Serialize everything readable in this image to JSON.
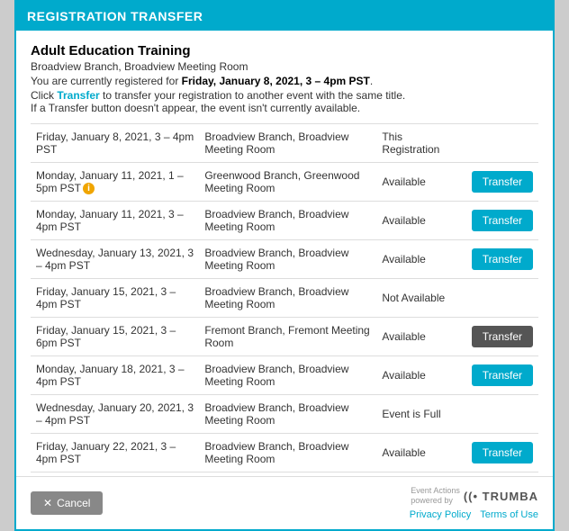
{
  "modal": {
    "header": "REGISTRATION TRANSFER",
    "event_title": "Adult Education Training",
    "event_location": "Broadview Branch, Broadview Meeting Room",
    "event_desc_prefix": "You are currently registered for ",
    "event_desc_bold": "Friday, January 8, 2021, 3 – 4pm PST",
    "event_desc_suffix": ".",
    "event_note_prefix": "Click ",
    "event_note_link": "Transfer",
    "event_note_suffix": " to transfer your registration to another event with the same title.",
    "event_note2": "If a Transfer button doesn't appear, the event isn't currently available."
  },
  "rows": [
    {
      "date": "Friday, January 8, 2021, 3 – 4pm PST",
      "location": "Broadview Branch, Broadview Meeting Room",
      "status": "This Registration",
      "has_button": false,
      "has_info": false,
      "active": false
    },
    {
      "date": "Monday, January 11, 2021, 1 – 5pm PST",
      "location": "Greenwood Branch, Greenwood Meeting Room",
      "status": "Available",
      "has_button": true,
      "has_info": true,
      "active": false
    },
    {
      "date": "Monday, January 11, 2021, 3 – 4pm PST",
      "location": "Broadview Branch, Broadview Meeting Room",
      "status": "Available",
      "has_button": true,
      "has_info": false,
      "active": false
    },
    {
      "date": "Wednesday, January 13, 2021, 3 – 4pm PST",
      "location": "Broadview Branch, Broadview Meeting Room",
      "status": "Available",
      "has_button": true,
      "has_info": false,
      "active": false
    },
    {
      "date": "Friday, January 15, 2021, 3 – 4pm PST",
      "location": "Broadview Branch, Broadview Meeting Room",
      "status": "Not Available",
      "has_button": false,
      "has_info": false,
      "active": false
    },
    {
      "date": "Friday, January 15, 2021, 3 – 6pm PST",
      "location": "Fremont Branch, Fremont Meeting Room",
      "status": "Available",
      "has_button": true,
      "has_info": false,
      "active": true
    },
    {
      "date": "Monday, January 18, 2021, 3 – 4pm PST",
      "location": "Broadview Branch, Broadview Meeting Room",
      "status": "Available",
      "has_button": true,
      "has_info": false,
      "active": false
    },
    {
      "date": "Wednesday, January 20, 2021, 3 – 4pm PST",
      "location": "Broadview Branch, Broadview Meeting Room",
      "status": "Event is Full",
      "has_button": false,
      "has_info": false,
      "active": false
    },
    {
      "date": "Friday, January 22, 2021, 3 – 4pm PST",
      "location": "Broadview Branch, Broadview Meeting Room",
      "status": "Available",
      "has_button": true,
      "has_info": false,
      "active": false
    }
  ],
  "footer": {
    "cancel_label": "Cancel",
    "trumba_line1": "Event Actions",
    "trumba_line2": "powered by",
    "trumba_brand": "((• TRUMBA",
    "privacy_policy": "Privacy Policy",
    "terms_of_use": "Terms of Use"
  }
}
